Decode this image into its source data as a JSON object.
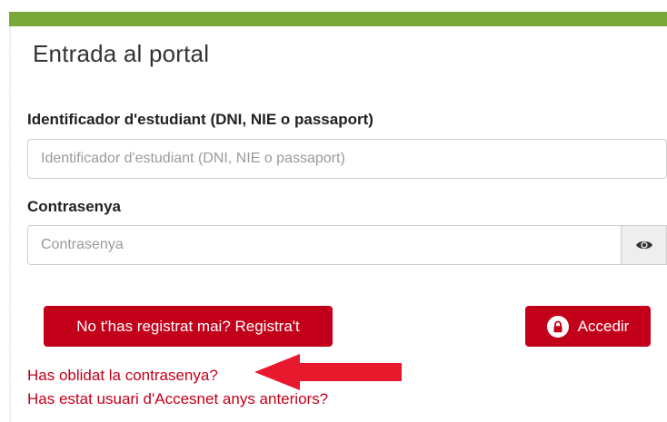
{
  "header": {
    "title": "Entrada al portal",
    "accent_color": "#7aa83b"
  },
  "form": {
    "id_label": "Identificador d'estudiant (DNI, NIE o passaport)",
    "id_placeholder": "Identificador d'estudiant (DNI, NIE o passaport)",
    "id_value": "",
    "password_label": "Contrasenya",
    "password_placeholder": "Contrasenya",
    "password_value": "",
    "show_password_icon": "eye-icon"
  },
  "buttons": {
    "register_label": "No t'has registrat mai? Registra't",
    "login_label": "Accedir",
    "login_icon": "lock-icon",
    "color": "#c3001a"
  },
  "links": {
    "forgot_password": "Has oblidat la contrasenya?",
    "previous_user": "Has estat usuari d'Accesnet anys anteriors?"
  },
  "annotation": {
    "arrow_color": "#e8192c",
    "arrow_icon": "left-arrow-icon"
  }
}
